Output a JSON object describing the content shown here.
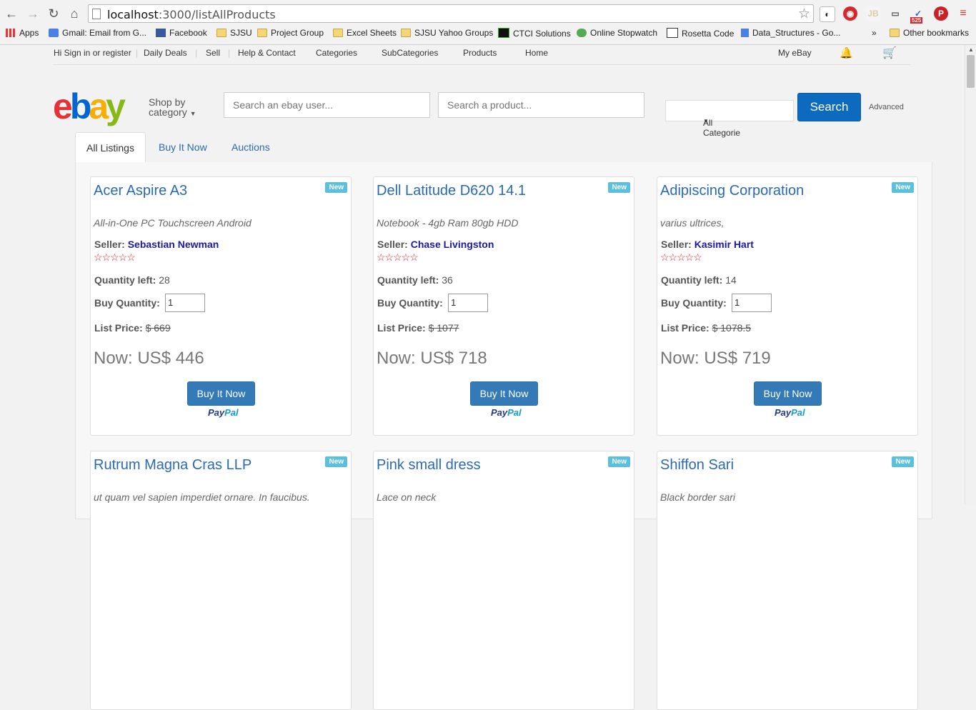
{
  "browser": {
    "url_host": "localhost",
    "url_path": ":3000/listAllProducts",
    "ext_badge": "525",
    "bookmarks": [
      {
        "label": "Apps",
        "icon": "apps-grid-icon"
      },
      {
        "label": "Gmail: Email from G...",
        "icon": "google-icon"
      },
      {
        "label": "Facebook",
        "icon": "facebook-icon"
      },
      {
        "label": "SJSU",
        "icon": "folder-icon"
      },
      {
        "label": "Project Group",
        "icon": "folder-icon"
      },
      {
        "label": "Excel Sheets",
        "icon": "folder-icon"
      },
      {
        "label": "SJSU Yahoo Groups",
        "icon": "folder-icon"
      },
      {
        "label": "CTCI Solutions",
        "icon": "ctci-icon"
      },
      {
        "label": "Online Stopwatch",
        "icon": "stopwatch-icon"
      },
      {
        "label": "Rosetta Code",
        "icon": "rosetta-icon"
      },
      {
        "label": "Data_Structures - Go...",
        "icon": "doc-icon"
      },
      {
        "label": "»",
        "icon": ""
      },
      {
        "label": "Other bookmarks",
        "icon": "folder-icon"
      }
    ]
  },
  "topnav": {
    "signin": "Hi Sign in or register",
    "daily_deals": "Daily Deals",
    "sell": "Sell",
    "help": "Help & Contact",
    "categories": "Categories",
    "subcategories": "SubCategories",
    "products": "Products",
    "home": "Home",
    "my_ebay": "My eBay"
  },
  "header": {
    "shop_by": "Shop by",
    "category": "category",
    "user_search_placeholder": "Search an ebay user...",
    "product_search_placeholder": "Search a product...",
    "category_select": "All Categorie",
    "search_button": "Search",
    "advanced": "Advanced"
  },
  "tabs": [
    "All Listings",
    "Buy It Now",
    "Auctions"
  ],
  "labels": {
    "seller": "Seller:",
    "quantity_left": "Quantity left:",
    "buy_quantity": "Buy Quantity:",
    "list_price": "List Price:",
    "buy_it_now": "Buy It Now",
    "new_badge": "New",
    "paypal_1": "Pay",
    "paypal_2": "Pal",
    "stars": "☆☆☆☆☆"
  },
  "products": [
    {
      "title": "Acer Aspire A3",
      "desc": "All-in-One PC Touchscreen Android",
      "seller": "Sebastian Newman",
      "qty_left": "28",
      "buy_qty": "1",
      "list_price": "$ 669",
      "now": "Now: US$ 446"
    },
    {
      "title": "Dell Latitude D620 14.1",
      "desc": "Notebook - 4gb Ram 80gb HDD",
      "seller": "Chase Livingston",
      "qty_left": "36",
      "buy_qty": "1",
      "list_price": "$ 1077",
      "now": "Now: US$ 718"
    },
    {
      "title": "Adipiscing Corporation",
      "desc": "varius ultrices,",
      "seller": "Kasimir Hart",
      "qty_left": "14",
      "buy_qty": "1",
      "list_price": "$ 1078.5",
      "now": "Now: US$ 719"
    },
    {
      "title": "Rutrum Magna Cras LLP",
      "desc": "ut quam vel sapien imperdiet ornare. In faucibus."
    },
    {
      "title": "Pink small dress",
      "desc": "Lace on neck"
    },
    {
      "title": "Shiffon Sari",
      "desc": "Black border sari"
    }
  ]
}
